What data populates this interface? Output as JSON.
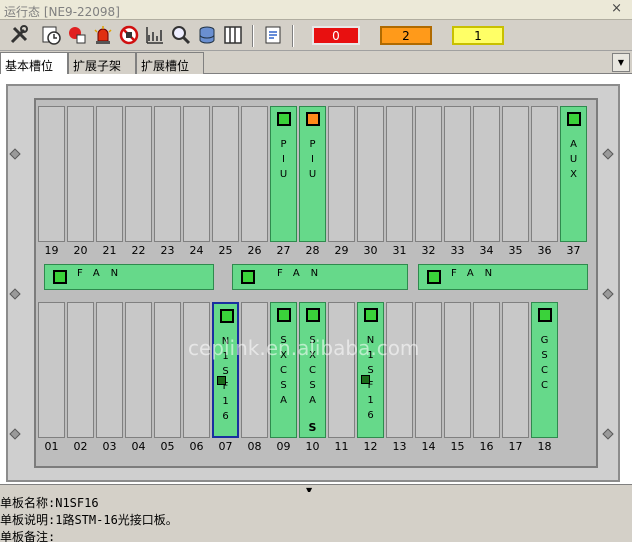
{
  "window": {
    "title": "运行态 [NE9-22098]",
    "close_glyph": "×"
  },
  "toolbar": {
    "icons": [
      "tools-icon",
      "clock-icon",
      "alarm-browse-icon",
      "siren-icon",
      "mute-icon",
      "performance-chart-icon",
      "search-icon",
      "database-icon",
      "columns-icon",
      "document-icon"
    ],
    "alarms": {
      "critical": "0",
      "major": "2",
      "minor": "1"
    }
  },
  "tabs": {
    "basic": "基本槽位",
    "ext_subrack": "扩展子架",
    "ext_slot": "扩展槽位",
    "dropdown": "▼"
  },
  "top_row": {
    "slot_numbers": [
      "19",
      "20",
      "21",
      "22",
      "23",
      "24",
      "25",
      "26",
      "27",
      "28",
      "29",
      "30",
      "31",
      "32",
      "33",
      "34",
      "35",
      "36",
      "37"
    ],
    "boards": [
      {
        "slot": "27",
        "letters": [
          "P",
          "I",
          "U"
        ],
        "led": "green"
      },
      {
        "slot": "28",
        "letters": [
          "P",
          "I",
          "U"
        ],
        "led": "orange"
      },
      {
        "slot": "37",
        "letters": [
          "A",
          "U",
          "X"
        ],
        "led": "green"
      }
    ]
  },
  "fans": [
    {
      "label": "FAN"
    },
    {
      "label": "FAN"
    },
    {
      "label": "FAN"
    }
  ],
  "bottom_row": {
    "slot_numbers": [
      "01",
      "02",
      "03",
      "04",
      "05",
      "06",
      "07",
      "08",
      "09",
      "10",
      "11",
      "12",
      "13",
      "14",
      "15",
      "16",
      "17",
      "18"
    ],
    "boards": [
      {
        "slot": "07",
        "letters": [
          "N",
          "1",
          "S",
          "F",
          "1",
          "6"
        ],
        "led": "green",
        "selected": true,
        "chip": true
      },
      {
        "slot": "09",
        "letters": [
          "S",
          "X",
          "C",
          "S",
          "A"
        ],
        "led": "green"
      },
      {
        "slot": "10",
        "letters": [
          "S",
          "X",
          "C",
          "S",
          "A"
        ],
        "led": "green",
        "mark": "S"
      },
      {
        "slot": "12",
        "letters": [
          "N",
          "1",
          "S",
          "F",
          "1",
          "6"
        ],
        "led": "green",
        "chip": true
      },
      {
        "slot": "18",
        "letters": [
          "G",
          "S",
          "C",
          "C"
        ],
        "led": "green"
      }
    ]
  },
  "watermark": "ceplink.en.alibaba.com",
  "info": {
    "name": "单板名称:N1SF16",
    "desc": "单板说明:1路STM-16光接口板。",
    "note": "单板备注:"
  },
  "colors": {
    "board": "#66d98a",
    "slot": "#c8c8c8",
    "led_green": "#3ad23a",
    "led_orange": "#ff8a1a",
    "selected_border": "#1a2fa0"
  }
}
